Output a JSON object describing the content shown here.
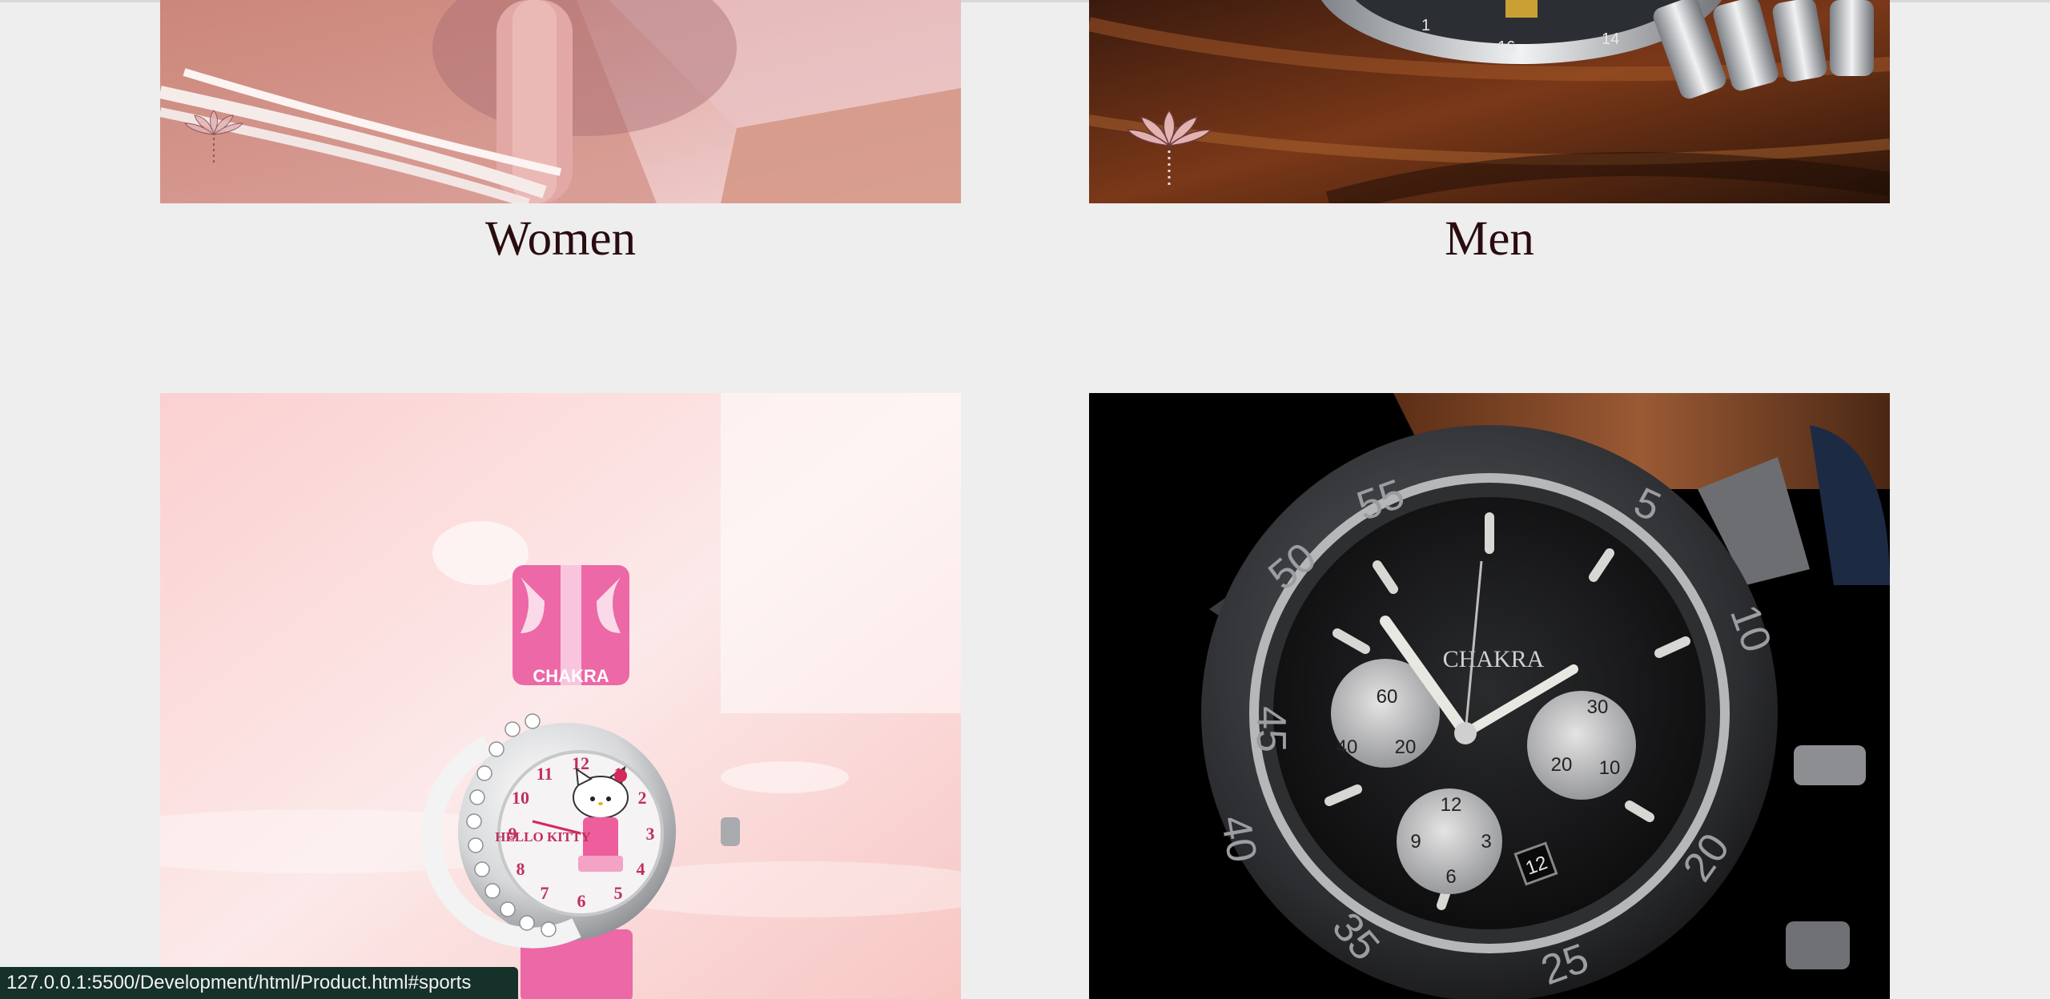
{
  "categories": [
    {
      "label": "Women",
      "image": "women-watch-photo"
    },
    {
      "label": "Men",
      "image": "men-watch-photo"
    }
  ],
  "products": [
    {
      "brand": "CHAKRA",
      "dial_text": "HELLO KITTY",
      "image": "kids-watch-photo"
    },
    {
      "brand": "CHAKRA",
      "image": "sports-watch-photo"
    }
  ],
  "men_watch_numerals": [
    "1",
    "16",
    "14"
  ],
  "sports_watch": {
    "bezel_numbers": [
      "50",
      "55",
      "5",
      "10",
      "40",
      "45",
      "35",
      "25",
      "20"
    ],
    "subdial_left": [
      "60",
      "40",
      "20"
    ],
    "subdial_right": [
      "30",
      "20",
      "10"
    ],
    "subdial_bottom": [
      "12",
      "9",
      "3",
      "6"
    ],
    "date": "12"
  },
  "kids_watch_numerals": [
    "12",
    "1",
    "2",
    "3",
    "4",
    "5",
    "6",
    "7",
    "8",
    "9",
    "10",
    "11"
  ],
  "status_bar": {
    "url": "127.0.0.1:5500/Development/html/Product.html#sports"
  },
  "colors": {
    "page_bg": "#eeeeee",
    "caption_text": "#2a0c10",
    "status_bg": "#16302a"
  }
}
